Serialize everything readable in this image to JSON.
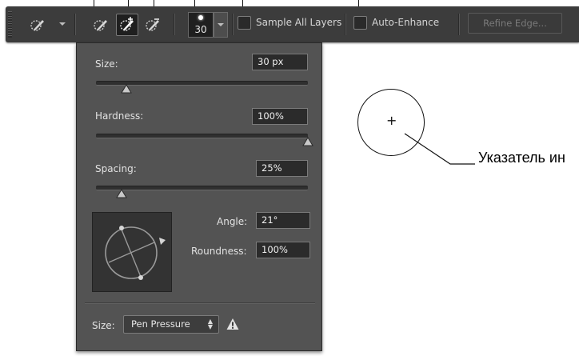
{
  "options_bar": {
    "tools": [
      {
        "name": "quick-selection-tool",
        "icon": "quick-selection-brush-icon"
      },
      {
        "name": "new-selection-tool",
        "icon": "quick-selection-brush-icon"
      },
      {
        "name": "add-to-selection-tool",
        "icon": "quick-selection-add-icon",
        "active": true
      },
      {
        "name": "subtract-from-selection-tool",
        "icon": "quick-selection-subtract-icon"
      }
    ],
    "brush_size": "30",
    "sample_all_layers_label": "Sample All Layers",
    "sample_all_layers_checked": false,
    "auto_enhance_label": "Auto-Enhance",
    "auto_enhance_checked": false,
    "refine_edge_label": "Refine Edge...",
    "refine_edge_enabled": false
  },
  "brush_panel": {
    "size_label": "Size:",
    "size_value": "30 px",
    "size_slider_fraction": 0.14,
    "hardness_label": "Hardness:",
    "hardness_value": "100%",
    "hardness_slider_fraction": 1.0,
    "spacing_label": "Spacing:",
    "spacing_value": "25%",
    "spacing_slider_fraction": 0.12,
    "angle_label": "Angle:",
    "angle_value": "21°",
    "roundness_label": "Roundness:",
    "roundness_value": "100%",
    "pressure_size_label": "Size:",
    "pressure_size_option": "Pen Pressure",
    "warning_icon": "warning-triangle-icon"
  },
  "canvas": {
    "pointer_label": "Указатель ин"
  },
  "colors": {
    "bar_bg": "#3c3c3c",
    "panel_bg": "#535353",
    "field_bg": "#2b2b2b",
    "label_text": "#e2e2e2"
  }
}
